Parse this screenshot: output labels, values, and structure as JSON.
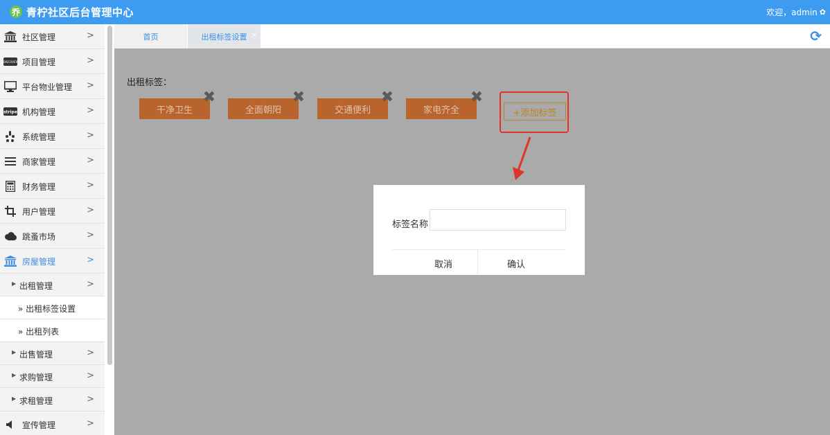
{
  "header": {
    "title": "青柠社区后台管理中心",
    "welcome": "欢迎，admin"
  },
  "sidebar": {
    "items": [
      {
        "label": "社区管理",
        "icon": "bank-icon"
      },
      {
        "label": "项目管理",
        "icon": "discover-card-icon"
      },
      {
        "label": "平台物业管理",
        "icon": "monitor-icon"
      },
      {
        "label": "机构管理",
        "icon": "stripe-icon"
      },
      {
        "label": "系统管理",
        "icon": "yelp-icon"
      },
      {
        "label": "商家管理",
        "icon": "bars-icon"
      },
      {
        "label": "财务管理",
        "icon": "calculator-icon"
      },
      {
        "label": "用户管理",
        "icon": "crop-icon"
      },
      {
        "label": "跳蚤市场",
        "icon": "cloud-icon"
      },
      {
        "label": "房屋管理",
        "icon": "bank-icon"
      }
    ],
    "sub_rent": "出租管理",
    "sub_rent_children": [
      "出租标签设置",
      "出租列表"
    ],
    "sub_sale": "出售管理",
    "sub_buy": "求购管理",
    "sub_wantrent": "求租管理",
    "promo": "宣传管理"
  },
  "tabs": {
    "home": "首页",
    "current": "出租标签设置"
  },
  "content": {
    "tags_label": "出租标签：",
    "tags": [
      "干净卫生",
      "全面朝阳",
      "交通便利",
      "家电齐全"
    ],
    "add_button": "+添加标签"
  },
  "dialog": {
    "field_label": "标签名称",
    "field_value": "",
    "cancel": "取消",
    "confirm": "确认"
  }
}
